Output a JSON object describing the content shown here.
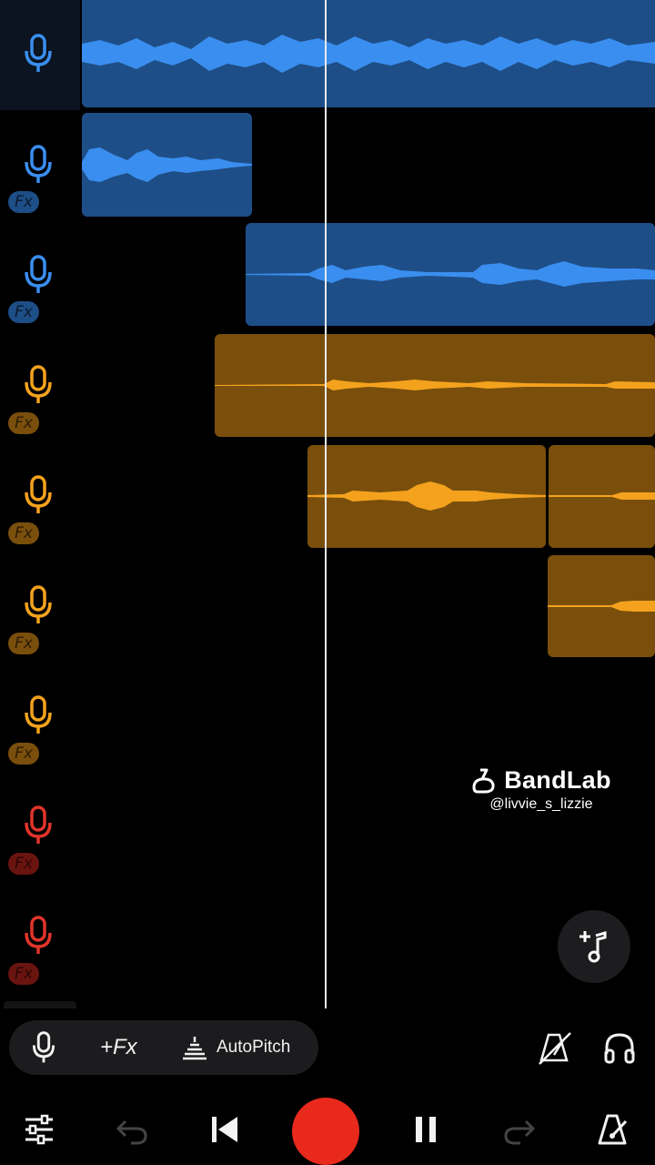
{
  "colors": {
    "blue_track": "#3a8eef",
    "blue_clip": "#1e4e87",
    "orange_track": "#f4a21d",
    "orange_clip": "#7a4f0c",
    "red_track": "#e0342a",
    "record": "#e8291c"
  },
  "tracks": [
    {
      "color": "blue",
      "icon": "mic-icon",
      "fx": false,
      "selected": true
    },
    {
      "color": "blue",
      "icon": "mic-icon",
      "fx": true,
      "fx_label": "Fx"
    },
    {
      "color": "blue",
      "icon": "mic-icon",
      "fx": true,
      "fx_label": "Fx"
    },
    {
      "color": "orange",
      "icon": "mic-icon",
      "fx": true,
      "fx_label": "Fx"
    },
    {
      "color": "orange",
      "icon": "mic-icon",
      "fx": true,
      "fx_label": "Fx"
    },
    {
      "color": "orange",
      "icon": "mic-icon",
      "fx": true,
      "fx_label": "Fx"
    },
    {
      "color": "orange",
      "icon": "mic-icon",
      "fx": true,
      "fx_label": "Fx"
    },
    {
      "color": "red",
      "icon": "mic-icon",
      "fx": true,
      "fx_label": "Fx"
    },
    {
      "color": "red",
      "icon": "mic-icon",
      "fx": true,
      "fx_label": "Fx"
    }
  ],
  "watermark": {
    "brand": "BandLab",
    "handle": "@livvie_s_lizzie",
    "icon": "bandlab-logo-icon"
  },
  "add_track_button": {
    "icon": "add-note-icon"
  },
  "toolbar": {
    "mic_icon": "mic-icon",
    "fx_label": "+Fx",
    "autopitch_label": "AutoPitch",
    "autopitch_icon": "autopitch-icon",
    "metronome_icon": "metronome-off-icon",
    "headphones_icon": "headphones-icon"
  },
  "transport": {
    "mixer_icon": "sliders-icon",
    "undo_icon": "undo-icon",
    "rewind_icon": "skip-to-start-icon",
    "record_icon": "record-icon",
    "pause_icon": "pause-icon",
    "redo_icon": "redo-icon",
    "tuner_icon": "metronome-icon"
  }
}
